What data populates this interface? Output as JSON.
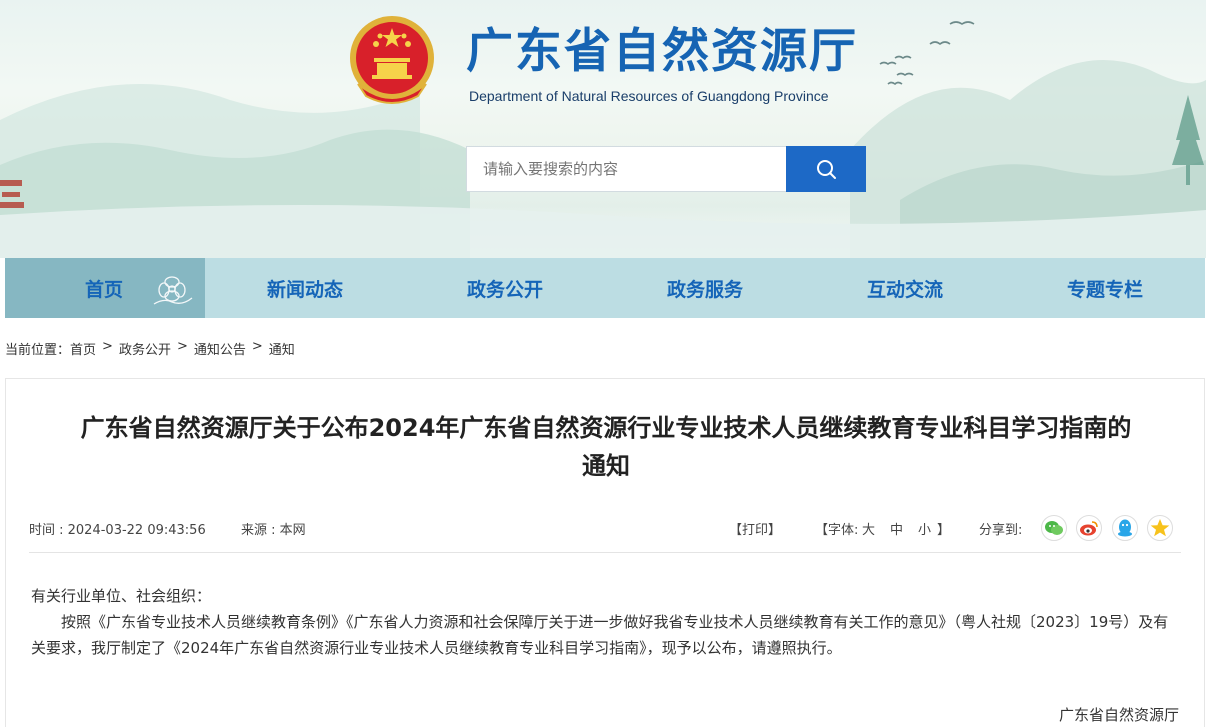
{
  "header": {
    "title": "广东省自然资源厅",
    "subtitle": "Department of Natural Resources of Guangdong Province",
    "search_placeholder": "请输入要搜索的内容"
  },
  "nav": {
    "items": [
      {
        "label": "首页"
      },
      {
        "label": "新闻动态"
      },
      {
        "label": "政务公开"
      },
      {
        "label": "政务服务"
      },
      {
        "label": "互动交流"
      },
      {
        "label": "专题专栏"
      }
    ]
  },
  "breadcrumb": {
    "prefix": "当前位置：",
    "items": [
      "首页",
      "政务公开",
      "通知公告",
      "通知"
    ],
    "separator": ">"
  },
  "article": {
    "title_line1": "广东省自然资源厅关于公布2024年广东省自然资源行业专业技术人员继续教育专业科目学习指南的",
    "title_line2": "通知",
    "time": "时间 : 2024-03-22 09:43:56",
    "source": "来源 : 本网",
    "print": "【打印】",
    "font_size_label": "【字体:",
    "font_large": "大",
    "font_medium": "中",
    "font_small": "小",
    "font_close": "】",
    "share_label": "分享到:",
    "share_icons": [
      "wechat-icon",
      "weibo-icon",
      "qq-icon",
      "qzone-icon"
    ],
    "greeting": "有关行业单位、社会组织：",
    "paragraph": "按照《广东省专业技术人员继续教育条例》《广东省人力资源和社会保障厅关于进一步做好我省专业技术人员继续教育有关工作的意见》（粤人社规〔2023〕19号）及有关要求，我厅制定了《2024年广东省自然资源行业专业技术人员继续教育专业科目学习指南》，现予以公布，请遵照执行。",
    "signature": "广东省自然资源厅"
  },
  "colors": {
    "title_blue": "#1664b3",
    "nav_bg": "#bcdde3",
    "nav_active_bg": "#86b7c2",
    "search_button": "#1d69c6"
  }
}
